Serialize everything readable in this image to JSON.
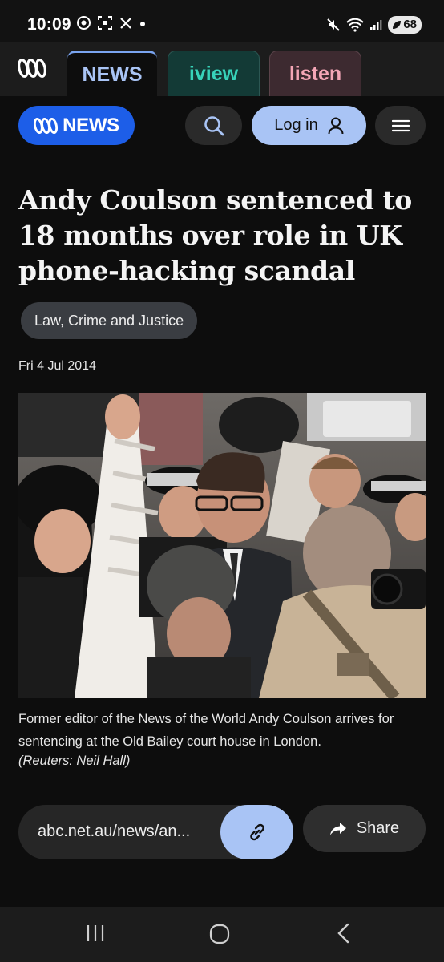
{
  "status_bar": {
    "time": "10:09",
    "battery": "68"
  },
  "site_tabs": {
    "news": "NEWS",
    "iview": "iview",
    "listen": "listen"
  },
  "header": {
    "logo_text": "NEWS",
    "login_label": "Log in"
  },
  "article": {
    "headline": "Andy Coulson sentenced to 18 months over role in UK phone-hacking scandal",
    "topic": "Law, Crime and Justice",
    "date": "Fri 4 Jul 2014",
    "caption": "Former editor of the News of the World Andy Coulson arrives for sentencing at the Old Bailey court house in London.",
    "credit": "(Reuters: Neil Hall)"
  },
  "share": {
    "url": "abc.net.au/news/an...",
    "share_label": "Share"
  },
  "colors": {
    "accent": "#1d5ee8",
    "login_bg": "#a9c4f5",
    "iview": "#37d3b9",
    "listen": "#f4a6b6"
  },
  "icons": [
    "abc-logo",
    "search-icon",
    "user-icon",
    "menu-icon",
    "link-icon",
    "share-arrow-icon",
    "recent-apps-icon",
    "home-icon",
    "back-icon"
  ]
}
